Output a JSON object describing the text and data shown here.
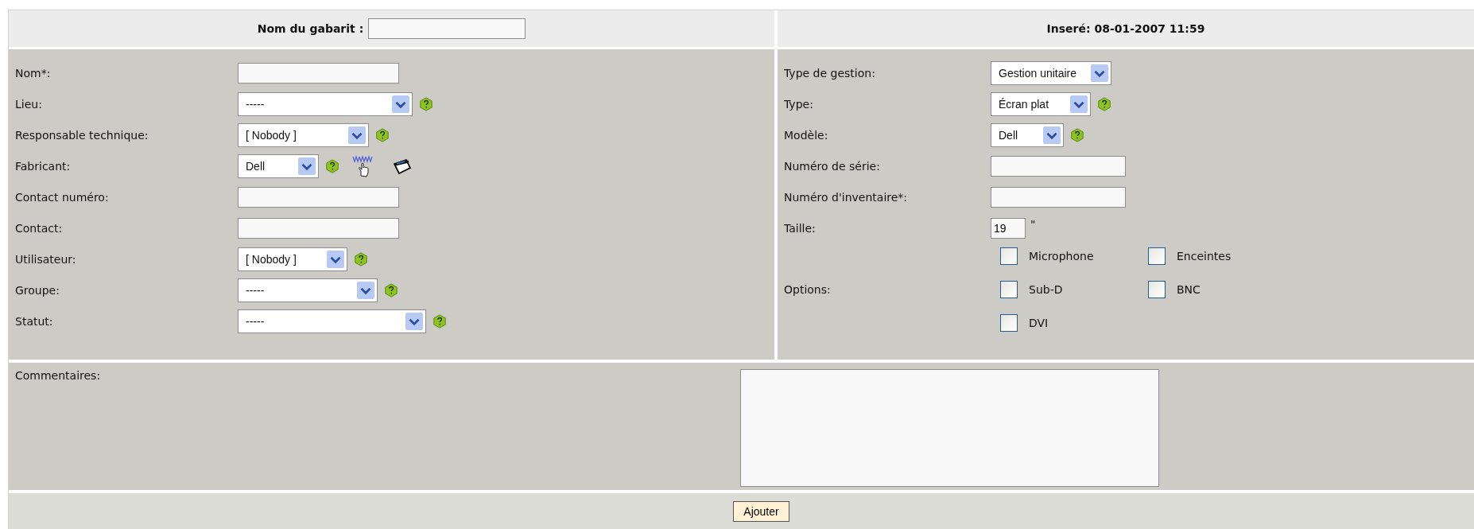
{
  "header": {
    "template_label": "Nom du gabarit :",
    "inserted": "Inseré: 08-01-2007 11:59"
  },
  "left_fields": [
    {
      "label": "Nom*:",
      "kind": "text",
      "help": false,
      "links": false
    },
    {
      "label": "Lieu:",
      "kind": "select",
      "value": "-----",
      "help": true,
      "links": false
    },
    {
      "label": "Responsable technique:",
      "kind": "select",
      "value": "[ Nobody ]",
      "help": true,
      "links": false
    },
    {
      "label": "Fabricant:",
      "kind": "select",
      "value": "Dell",
      "help": true,
      "links": true
    },
    {
      "label": "Contact numéro:",
      "kind": "text",
      "help": false,
      "links": false
    },
    {
      "label": "Contact:",
      "kind": "text",
      "help": false,
      "links": false
    },
    {
      "label": "Utilisateur:",
      "kind": "select",
      "value": "[ Nobody ]",
      "help": true,
      "links": false
    },
    {
      "label": "Groupe:",
      "kind": "select",
      "value": "-----",
      "help": true,
      "links": false
    },
    {
      "label": "Statut:",
      "kind": "select",
      "value": "-----",
      "help": true,
      "links": false
    }
  ],
  "right_fields": [
    {
      "label": "Type de gestion:",
      "kind": "select",
      "value": "Gestion unitaire",
      "help": false
    },
    {
      "label": "Type:",
      "kind": "select",
      "value": "Écran plat",
      "help": true
    },
    {
      "label": "Modèle:",
      "kind": "select",
      "value": "Dell",
      "help": true
    },
    {
      "label": "Numéro de série:",
      "kind": "text",
      "help": false
    },
    {
      "label": "Numéro d'inventaire*:",
      "kind": "text",
      "help": false
    },
    {
      "label": "Taille:",
      "kind": "size",
      "value": "19",
      "unit": "\"",
      "help": false
    }
  ],
  "options": {
    "label": "Options:",
    "items": [
      {
        "label": "Microphone",
        "checked": false
      },
      {
        "label": "Enceintes",
        "checked": false
      },
      {
        "label": "Sub-D",
        "checked": false
      },
      {
        "label": "BNC",
        "checked": false
      },
      {
        "label": "DVI",
        "checked": false
      }
    ]
  },
  "comments": {
    "label": "Commentaires:"
  },
  "submit": "Ajouter"
}
